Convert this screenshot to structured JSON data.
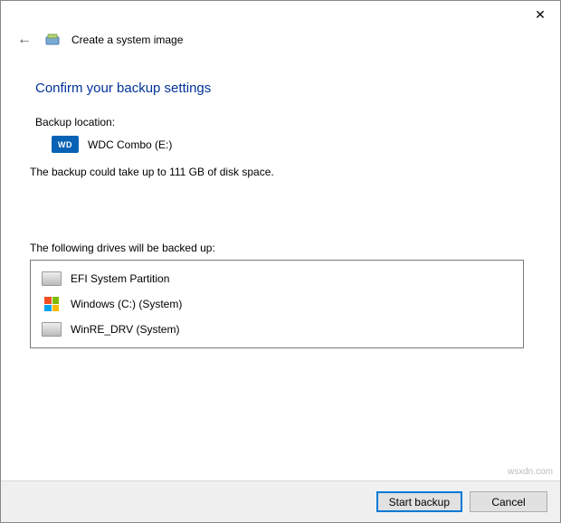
{
  "window": {
    "close_glyph": "✕"
  },
  "header": {
    "back_glyph": "←",
    "title": "Create a system image"
  },
  "page": {
    "heading": "Confirm your backup settings",
    "backup_location_label": "Backup location:",
    "backup_location_badge": "WD",
    "backup_location_name": "WDC Combo (E:)",
    "space_note": "The backup could take up to 111 GB of disk space.",
    "drives_label": "The following drives will be backed up:",
    "drives": [
      {
        "icon": "hdd",
        "name": "EFI System Partition"
      },
      {
        "icon": "windows",
        "name": "Windows (C:) (System)"
      },
      {
        "icon": "hdd",
        "name": "WinRE_DRV (System)"
      }
    ]
  },
  "footer": {
    "start_label": "Start backup",
    "cancel_label": "Cancel"
  },
  "watermark": "wsxdn.com"
}
